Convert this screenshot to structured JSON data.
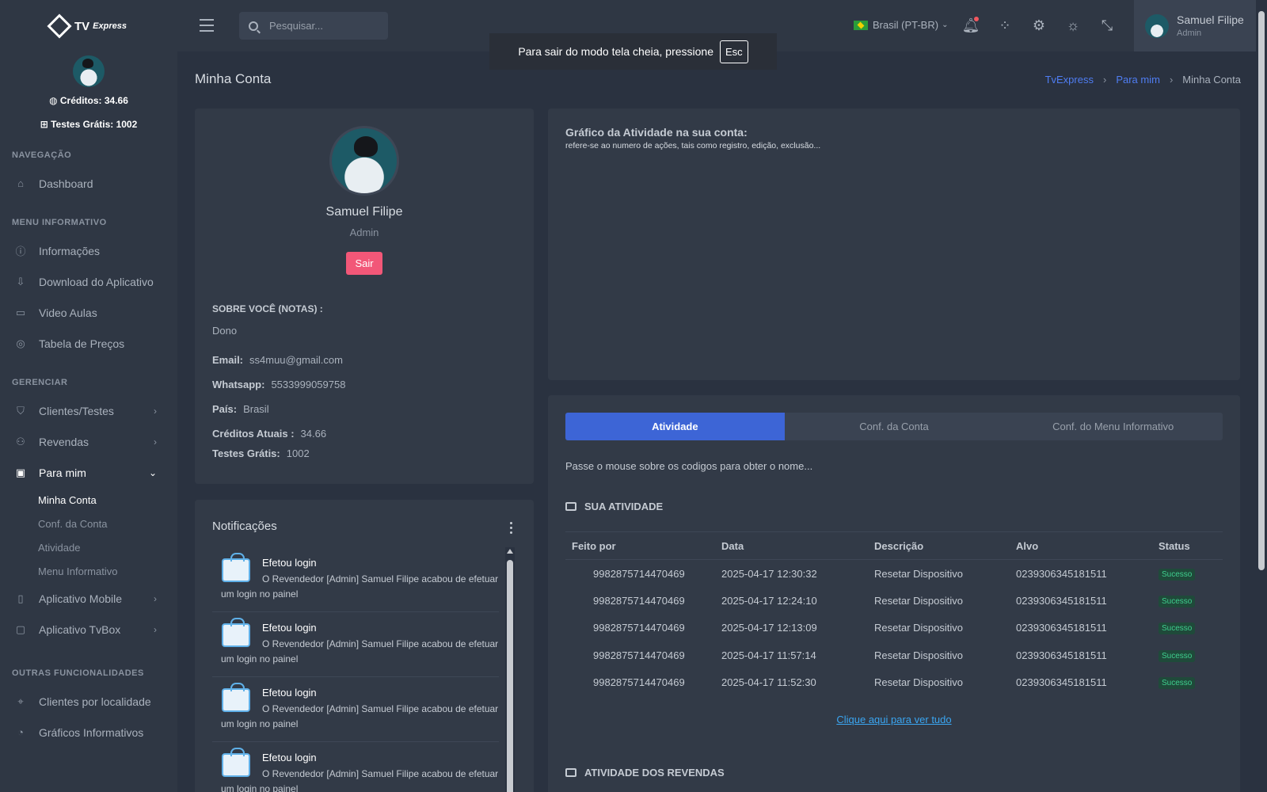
{
  "app": {
    "logo_text": "TV",
    "logo_italic": "Express"
  },
  "sidebar": {
    "credits": "Créditos: 34.66",
    "free_tests": "Testes Grátis: 1002",
    "sections": {
      "nav": "NAVEGAÇÃO",
      "menu": "MENU INFORMATIVO",
      "manage": "GERENCIAR",
      "other": "OUTRAS FUNCIONALIDADES"
    },
    "items": {
      "dashboard": "Dashboard",
      "info": "Informações",
      "download": "Download do Aplicativo",
      "videos": "Video Aulas",
      "prices": "Tabela de Preços",
      "clients": "Clientes/Testes",
      "resellers": "Revendas",
      "me": "Para mim",
      "mobile": "Aplicativo Mobile",
      "tvbox": "Aplicativo TvBox",
      "by_location": "Clientes por localidade",
      "charts": "Gráficos Informativos"
    },
    "sub_items": {
      "account": "Minha Conta",
      "conf": "Conf. da Conta",
      "activity": "Atividade",
      "menu": "Menu Informativo"
    }
  },
  "topbar": {
    "search_placeholder": "Pesquisar...",
    "language": "Brasil (PT-BR)",
    "user_name": "Samuel Filipe",
    "user_role": "Admin"
  },
  "toast": {
    "text": "Para sair do modo tela cheia, pressione",
    "key": "Esc"
  },
  "page": {
    "title": "Minha Conta",
    "breadcrumb": [
      "TvExpress",
      "Para mim",
      "Minha Conta"
    ]
  },
  "profile": {
    "name": "Samuel Filipe",
    "role": "Admin",
    "logout": "Sair",
    "about_label": "SOBRE VOCÊ (NOTAS) :",
    "about_value": "Dono",
    "fields": [
      {
        "label": "Email:",
        "value": "ss4muu@gmail.com"
      },
      {
        "label": "Whatsapp:",
        "value": "5533999059758"
      },
      {
        "label": "País:",
        "value": "Brasil"
      },
      {
        "label": "Créditos Atuais :",
        "value": "34.66"
      },
      {
        "label": "Testes Grátis:",
        "value": "1002"
      }
    ]
  },
  "notifications": {
    "title": "Notificações",
    "items": [
      {
        "title": "Efetou login",
        "body": "O Revendedor [Admin] Samuel Filipe acabou de efetuar um login no painel"
      },
      {
        "title": "Efetou login",
        "body": "O Revendedor [Admin] Samuel Filipe acabou de efetuar um login no painel"
      },
      {
        "title": "Efetou login",
        "body": "O Revendedor [Admin] Samuel Filipe acabou de efetuar um login no painel"
      },
      {
        "title": "Efetou login",
        "body": "O Revendedor [Admin] Samuel Filipe acabou de efetuar um login no painel"
      }
    ]
  },
  "chart": {
    "title": "Gráfico da Atividade na sua conta:",
    "subtitle": "refere-se ao numero de ações, tais como registro, edição, exclusão..."
  },
  "activity": {
    "tabs": [
      "Atividade",
      "Conf. da Conta",
      "Conf. do Menu Informativo"
    ],
    "hover_note": "Passe o mouse sobre os codigos para obter o nome...",
    "section_title": "SUA ATIVIDADE",
    "columns": [
      "Feito por",
      "Data",
      "Descrição",
      "Alvo",
      "Status"
    ],
    "rows": [
      [
        "9982875714470469",
        "2025-04-17 12:30:32",
        "Resetar Dispositivo",
        "0239306345181511",
        "Sucesso"
      ],
      [
        "9982875714470469",
        "2025-04-17 12:24:10",
        "Resetar Dispositivo",
        "0239306345181511",
        "Sucesso"
      ],
      [
        "9982875714470469",
        "2025-04-17 12:13:09",
        "Resetar Dispositivo",
        "0239306345181511",
        "Sucesso"
      ],
      [
        "9982875714470469",
        "2025-04-17 11:57:14",
        "Resetar Dispositivo",
        "0239306345181511",
        "Sucesso"
      ],
      [
        "9982875714470469",
        "2025-04-17 11:52:30",
        "Resetar Dispositivo",
        "0239306345181511",
        "Sucesso"
      ]
    ],
    "see_all": "Clique aqui para ver tudo",
    "resellers_title": "ATIVIDADE DOS REVENDAS"
  }
}
